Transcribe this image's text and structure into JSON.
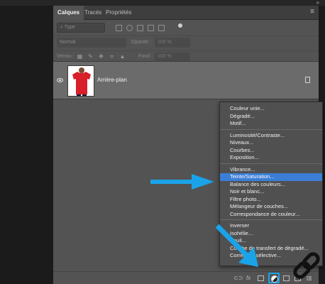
{
  "panel": {
    "tabs": [
      {
        "label": "Calques"
      },
      {
        "label": "Tracés"
      },
      {
        "label": "Propriétés"
      }
    ],
    "filter_placeholder": "Type",
    "blend_mode": "Normal",
    "opacity_label": "Opacité :",
    "opacity_value": "100 %",
    "lock_label": "Verrou :",
    "fill_label": "Fond :",
    "fill_value": "100 %"
  },
  "layer": {
    "name": "Arrière-plan",
    "thumbnail_color": "#d81f2a"
  },
  "menu": {
    "highlighted_index": 8,
    "highlight_color": "#3c7ed6",
    "groups": [
      [
        "Couleur unie...",
        "Dégradé...",
        "Motif..."
      ],
      [
        "Luminosité/Contraste...",
        "Niveaux...",
        "Courbes...",
        "Exposition..."
      ],
      [
        "Vibrance...",
        "Teinte/Saturation...",
        "Balance des couleurs...",
        "Noir et blanc...",
        "Filtre photo...",
        "Mélangeur de couches...",
        "Correspondance de couleur..."
      ],
      [
        "Inverser",
        "Isohélie...",
        "Seuil...",
        "Courbe de transfert de dégradé...",
        "Correction sélective..."
      ]
    ]
  },
  "bottom_bar": {
    "fx_label": "fx"
  },
  "colors": {
    "accent_arrow": "#1aa3e8",
    "panel_bg": "#535353",
    "menu_bg": "#505050"
  },
  "icons": [
    "link-icon",
    "fx-icon",
    "mask-icon",
    "adjustment-layer-icon",
    "group-folder-icon",
    "new-layer-icon",
    "trash-icon",
    "eye-icon",
    "lock-icon",
    "panel-menu-icon",
    "link-logo-icon"
  ]
}
